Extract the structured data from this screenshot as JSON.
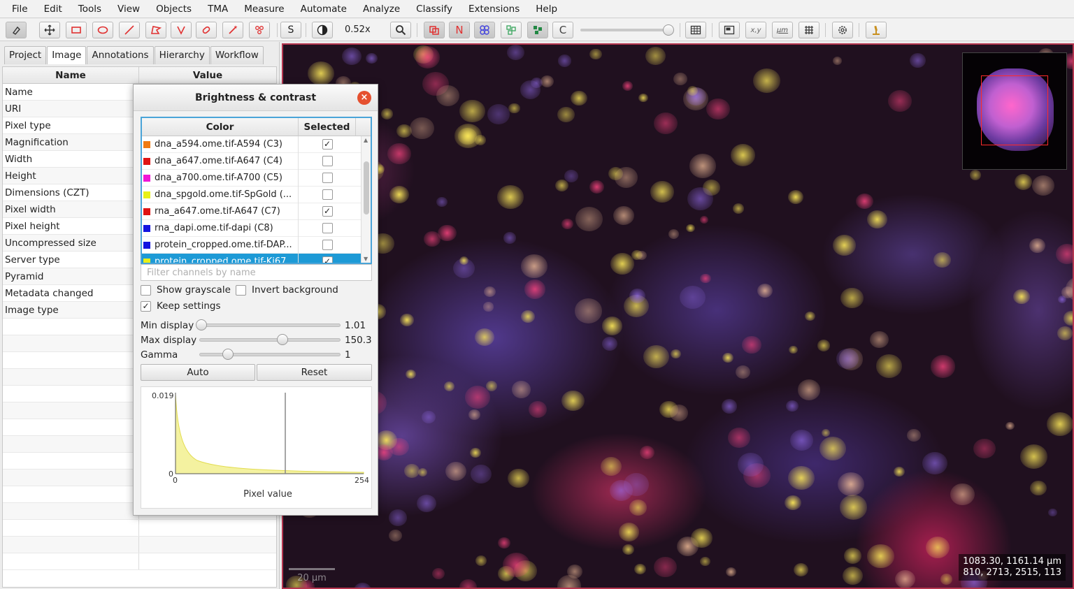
{
  "menu": [
    "File",
    "Edit",
    "Tools",
    "View",
    "Objects",
    "TMA",
    "Measure",
    "Automate",
    "Analyze",
    "Classify",
    "Extensions",
    "Help"
  ],
  "toolbar": {
    "tools": [
      {
        "name": "hand-tool-icon",
        "x": 8
      },
      {
        "name": "move-tool-icon",
        "x": 56
      },
      {
        "name": "rectangle-tool-icon",
        "x": 94
      },
      {
        "name": "ellipse-tool-icon",
        "x": 132
      },
      {
        "name": "line-tool-icon",
        "x": 170
      },
      {
        "name": "polygon-tool-icon",
        "x": 208
      },
      {
        "name": "polyline-tool-icon",
        "x": 244
      },
      {
        "name": "brush-tool-icon",
        "x": 280
      },
      {
        "name": "wand-tool-icon",
        "x": 318
      },
      {
        "name": "points-tool-icon",
        "x": 356
      }
    ],
    "selection_mode_label": "S",
    "zoom_label": "0.52x",
    "toggle_labels": {
      "names": "N",
      "counts": "C"
    },
    "measurement_labels": {
      "xy": "x,y",
      "microns": "µm"
    }
  },
  "left_panel": {
    "tabs": [
      "Project",
      "Image",
      "Annotations",
      "Hierarchy",
      "Workflow"
    ],
    "active_tab": "Image",
    "columns": {
      "name": "Name",
      "value": "Value"
    },
    "properties": [
      "Name",
      "URI",
      "Pixel type",
      "Magnification",
      "Width",
      "Height",
      "Dimensions (CZT)",
      "Pixel width",
      "Pixel height",
      "Uncompressed size",
      "Server type",
      "Pyramid",
      "Metadata changed",
      "Image type"
    ],
    "empty_rows": 15
  },
  "dialog": {
    "title": "Brightness & contrast",
    "close_icon": "×",
    "columns": {
      "color": "Color",
      "selected": "Selected"
    },
    "channels": [
      {
        "name": "dna_a594.ome.tif-A594 (C3)",
        "color": "#f07b12",
        "selected": true
      },
      {
        "name": "dna_a647.ome.tif-A647 (C4)",
        "color": "#e01414",
        "selected": false
      },
      {
        "name": "dna_a700.ome.tif-A700 (C5)",
        "color": "#f016d6",
        "selected": false
      },
      {
        "name": "dna_spgold.ome.tif-SpGold (...",
        "color": "#e8f018",
        "selected": false
      },
      {
        "name": "rna_a647.ome.tif-A647 (C7)",
        "color": "#e01414",
        "selected": true
      },
      {
        "name": "rna_dapi.ome.tif-dapi (C8)",
        "color": "#1414e0",
        "selected": false
      },
      {
        "name": "protein_cropped.ome.tif-DAP...",
        "color": "#1414e0",
        "selected": false
      },
      {
        "name": "protein_cropped.ome.tif-Ki67...",
        "color": "#e8f018",
        "selected": true,
        "highlighted": true
      }
    ],
    "filter_placeholder": "Filter channels by name",
    "show_grayscale": {
      "label": "Show grayscale",
      "checked": false
    },
    "invert_background": {
      "label": "Invert background",
      "checked": false
    },
    "keep_settings": {
      "label": "Keep settings",
      "checked": true
    },
    "min_display": {
      "label": "Min display",
      "value": "1.01"
    },
    "max_display": {
      "label": "Max display",
      "value": "150.3"
    },
    "gamma": {
      "label": "Gamma",
      "value": "1"
    },
    "auto_label": "Auto",
    "reset_label": "Reset",
    "histogram": {
      "xlabel": "Pixel value",
      "x_range": [
        0,
        254
      ],
      "y_max_label": "0.019",
      "y_min_label": "0",
      "x_min_label": "0",
      "x_max_label": "254"
    }
  },
  "viewer": {
    "coords_line1": "1083.30, 1161.14 µm",
    "coords_line2": "810, 2713, 2515, 113",
    "scalebar_label": "20 µm"
  },
  "checkmark": "✓"
}
